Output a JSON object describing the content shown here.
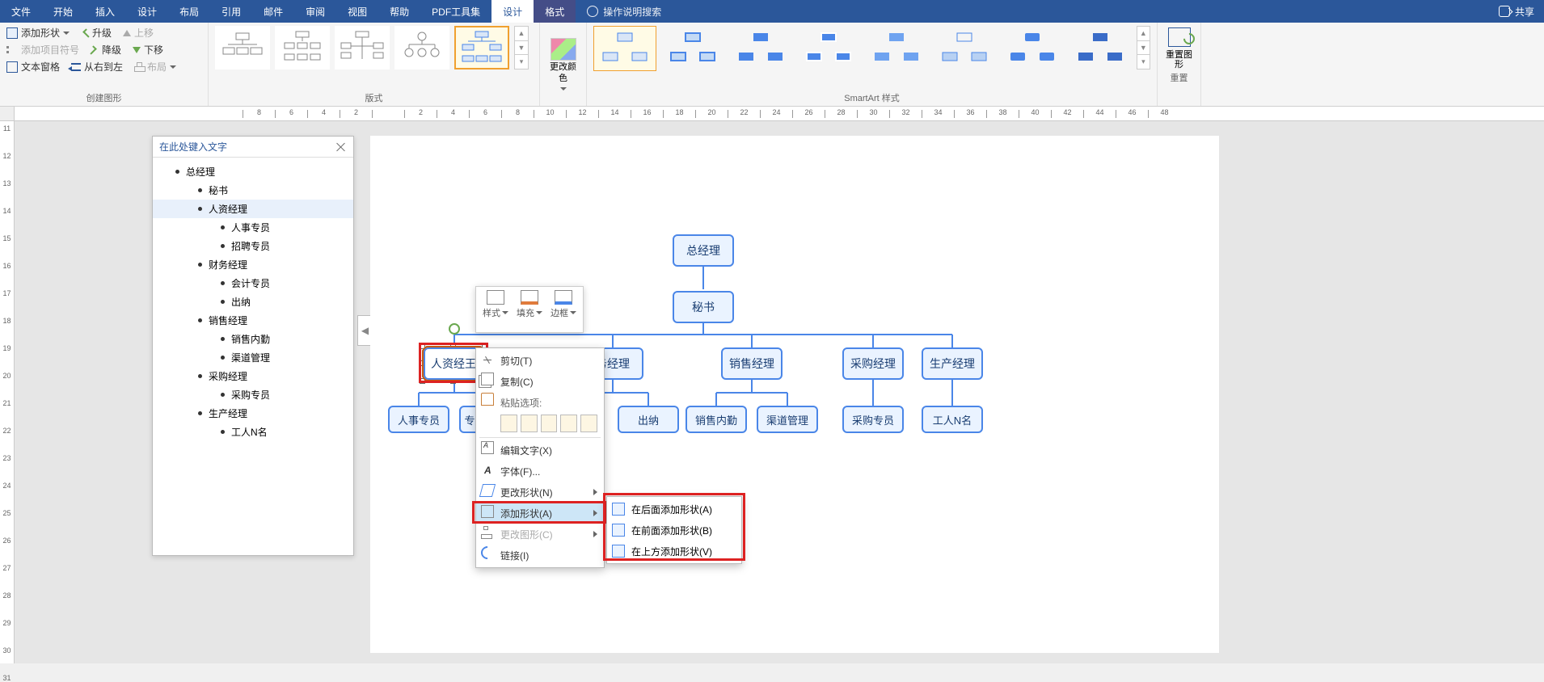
{
  "tabs": [
    "文件",
    "开始",
    "插入",
    "设计",
    "布局",
    "引用",
    "邮件",
    "审阅",
    "视图",
    "帮助",
    "PDF工具集",
    "设计",
    "格式"
  ],
  "active_tab_index": 11,
  "search_hint": "操作说明搜索",
  "share": "共享",
  "create_group": {
    "label": "创建图形",
    "add_shape": "添加形状",
    "add_bullet": "添加项目符号",
    "text_pane": "文本窗格",
    "promote": "升级",
    "demote": "降级",
    "rtl": "从右到左",
    "move_up": "上移",
    "move_down": "下移",
    "layout": "布局"
  },
  "layouts_label": "版式",
  "change_colors": "更改颜色",
  "styles_label": "SmartArt 样式",
  "reset_graphic": "重置图形",
  "reset_label": "重置",
  "textpane_title": "在此处键入文字",
  "outline": [
    {
      "lvl": 1,
      "t": "总经理"
    },
    {
      "lvl": 2,
      "t": "秘书"
    },
    {
      "lvl": 2,
      "t": "人资经理",
      "sel": true
    },
    {
      "lvl": 3,
      "t": "人事专员"
    },
    {
      "lvl": 3,
      "t": "招聘专员"
    },
    {
      "lvl": 2,
      "t": "财务经理"
    },
    {
      "lvl": 3,
      "t": "会计专员"
    },
    {
      "lvl": 3,
      "t": "出纳"
    },
    {
      "lvl": 2,
      "t": "销售经理"
    },
    {
      "lvl": 3,
      "t": "销售内勤"
    },
    {
      "lvl": 3,
      "t": "渠道管理"
    },
    {
      "lvl": 2,
      "t": "采购经理"
    },
    {
      "lvl": 3,
      "t": "采购专员"
    },
    {
      "lvl": 2,
      "t": "生产经理"
    },
    {
      "lvl": 3,
      "t": "工人N名"
    }
  ],
  "nodes": {
    "root": "总经理",
    "sec": "秘书",
    "m1": "人资经理",
    "m1a": "人事专员",
    "m1b": "招聘专员",
    "m2": "财务经理",
    "m2a": "会计专员",
    "m2b": "出纳",
    "m3": "销售经理",
    "m3a": "销售内勤",
    "m3b": "渠道管理",
    "m4": "采购经理",
    "m4a": "采购专员",
    "m5": "生产经理",
    "m5a": "工人N名",
    "m1_clip": "人资经王"
  },
  "mini_toolbar": {
    "style": "样式",
    "fill": "填充",
    "outline": "边框"
  },
  "ctx": {
    "cut": "剪切(T)",
    "copy": "复制(C)",
    "paste_label": "粘贴选项:",
    "edit_text": "编辑文字(X)",
    "font": "字体(F)...",
    "change_shape": "更改形状(N)",
    "add_shape": "添加形状(A)",
    "change_layout": "更改图形(C)",
    "link": "链接(I)"
  },
  "sub": {
    "after": "在后面添加形状(A)",
    "before": "在前面添加形状(B)",
    "above": "在上方添加形状(V)"
  },
  "ruler_h": [
    "8",
    "6",
    "4",
    "2",
    "",
    "2",
    "4",
    "6",
    "8",
    "10",
    "12",
    "14",
    "16",
    "18",
    "20",
    "22",
    "24",
    "26",
    "28",
    "30",
    "32",
    "34",
    "36",
    "38",
    "40",
    "42",
    "44",
    "46",
    "48"
  ],
  "ruler_v": [
    "11",
    "12",
    "13",
    "14",
    "15",
    "16",
    "17",
    "18",
    "19",
    "20",
    "21",
    "22",
    "23",
    "24",
    "25",
    "26",
    "27",
    "28",
    "29",
    "30",
    "31"
  ],
  "colors": {
    "accent": "#2b579a",
    "node_border": "#4a86e8",
    "node_bg": "#eaf3ff",
    "highlight": "#d22"
  }
}
